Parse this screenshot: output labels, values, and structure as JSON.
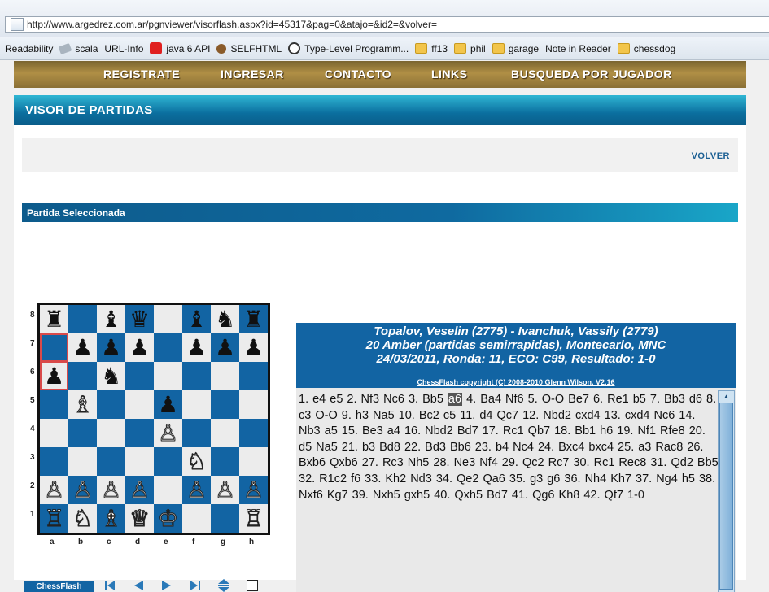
{
  "browser": {
    "url": "http://www.argedrez.com.ar/pgnviewer/visorflash.aspx?id=45317&pag=0&atajo=&id2=&volver=",
    "bookmarks": [
      {
        "label": "Readability",
        "icon": "page-icon"
      },
      {
        "label": "scala",
        "icon": "tag-icon"
      },
      {
        "label": "URL-Info",
        "icon": "page-icon"
      },
      {
        "label": "java 6 API",
        "icon": "java-icon"
      },
      {
        "label": "SELFHTML",
        "icon": "selfhtml-icon"
      },
      {
        "label": "Type-Level Programm...",
        "icon": "wordpress-icon"
      },
      {
        "label": "ff13",
        "icon": "folder-icon"
      },
      {
        "label": "phil",
        "icon": "folder-icon"
      },
      {
        "label": "garage",
        "icon": "folder-icon"
      },
      {
        "label": "Note in Reader",
        "icon": "page-icon"
      },
      {
        "label": "chessdog",
        "icon": "folder-icon"
      }
    ]
  },
  "nav": {
    "items": [
      "REGISTRATE",
      "INGRESAR",
      "CONTACTO",
      "LINKS",
      "BUSQUEDA POR JUGADOR"
    ]
  },
  "section_title": "VISOR DE PARTIDAS",
  "volver_label": "VOLVER",
  "partida_title": "Partida Seleccionada",
  "board": {
    "ranks": [
      "8",
      "7",
      "6",
      "5",
      "4",
      "3",
      "2",
      "1"
    ],
    "files": [
      "a",
      "b",
      "c",
      "d",
      "e",
      "f",
      "g",
      "h"
    ],
    "position": [
      [
        "br",
        "",
        "bb",
        "bq",
        "",
        "bb",
        "bn",
        "br"
      ],
      [
        "",
        "bp",
        "bp",
        "bp",
        "",
        "bp",
        "bp",
        "bp"
      ],
      [
        "bp",
        "",
        "bn",
        "",
        "",
        "",
        "",
        ""
      ],
      [
        "",
        "wb",
        "",
        "",
        "bp",
        "",
        "",
        ""
      ],
      [
        "",
        "",
        "",
        "",
        "wp",
        "",
        "",
        ""
      ],
      [
        "",
        "",
        "",
        "",
        "",
        "wn",
        "",
        ""
      ],
      [
        "wp",
        "wp",
        "wp",
        "wp",
        "",
        "wp",
        "wp",
        "wp"
      ],
      [
        "wr",
        "wn",
        "wb",
        "wq",
        "wk",
        "",
        "",
        "wr"
      ]
    ],
    "highlight": [
      "a7",
      "a6"
    ]
  },
  "controls": {
    "chessflash_label": "ChessFlash",
    "buttons": [
      "first-icon",
      "prev-icon",
      "next-icon",
      "last-icon",
      "flip-icon",
      "square-icon"
    ]
  },
  "game": {
    "line1": "Topalov, Veselin (2775) - Ivanchuk, Vassily (2779)",
    "line2": "20 Amber (partidas semirrapidas), Montecarlo, MNC",
    "line3": "24/03/2011, Ronda: 11, ECO: C99, Resultado: 1-0",
    "copyright": "ChessFlash copyright (C) 2008-2010 Glenn Wilson. V2.16",
    "moves_before": "1.  e4 e5 2.  Nf3 Nc6 3.  Bb5 ",
    "current_move": "a6",
    "moves_after": " 4.  Ba4 Nf6 5.  O-O Be7 6.  Re1 b5 7.  Bb3 d6 8.  c3 O-O 9.  h3 Na5 10.  Bc2 c5 11.  d4 Qc7 12.  Nbd2 cxd4 13.  cxd4 Nc6 14.  Nb3 a5 15.  Be3 a4 16.  Nbd2 Bd7 17.  Rc1 Qb7 18.  Bb1 h6 19.  Nf1 Rfe8 20.  d5 Na5 21.  b3 Bd8 22.  Bd3 Bb6 23.  b4 Nc4 24.  Bxc4 bxc4 25.  a3 Rac8 26.  Bxb6 Qxb6 27.  Rc3 Nh5 28.  Ne3 Nf4 29.  Qc2 Rc7 30.  Rc1 Rec8 31.  Qd2 Bb5 32.  R1c2 f6 33.  Kh2 Nd3 34.  Qe2 Qa6 35.  g3 g6 36.  Nh4 Kh7 37.  Ng4 h5 38.  Nxf6 Kg7 39.  Nxh5 gxh5 40.  Qxh5 Bd7 41.  Qg6 Kh8 42.  Qf7 ",
    "result": "1-0"
  },
  "colors": {
    "board_dark": "#1264a3",
    "board_light": "#ececec",
    "nav_gold": "#b08f45",
    "header_teal": "#0b6f9f"
  }
}
